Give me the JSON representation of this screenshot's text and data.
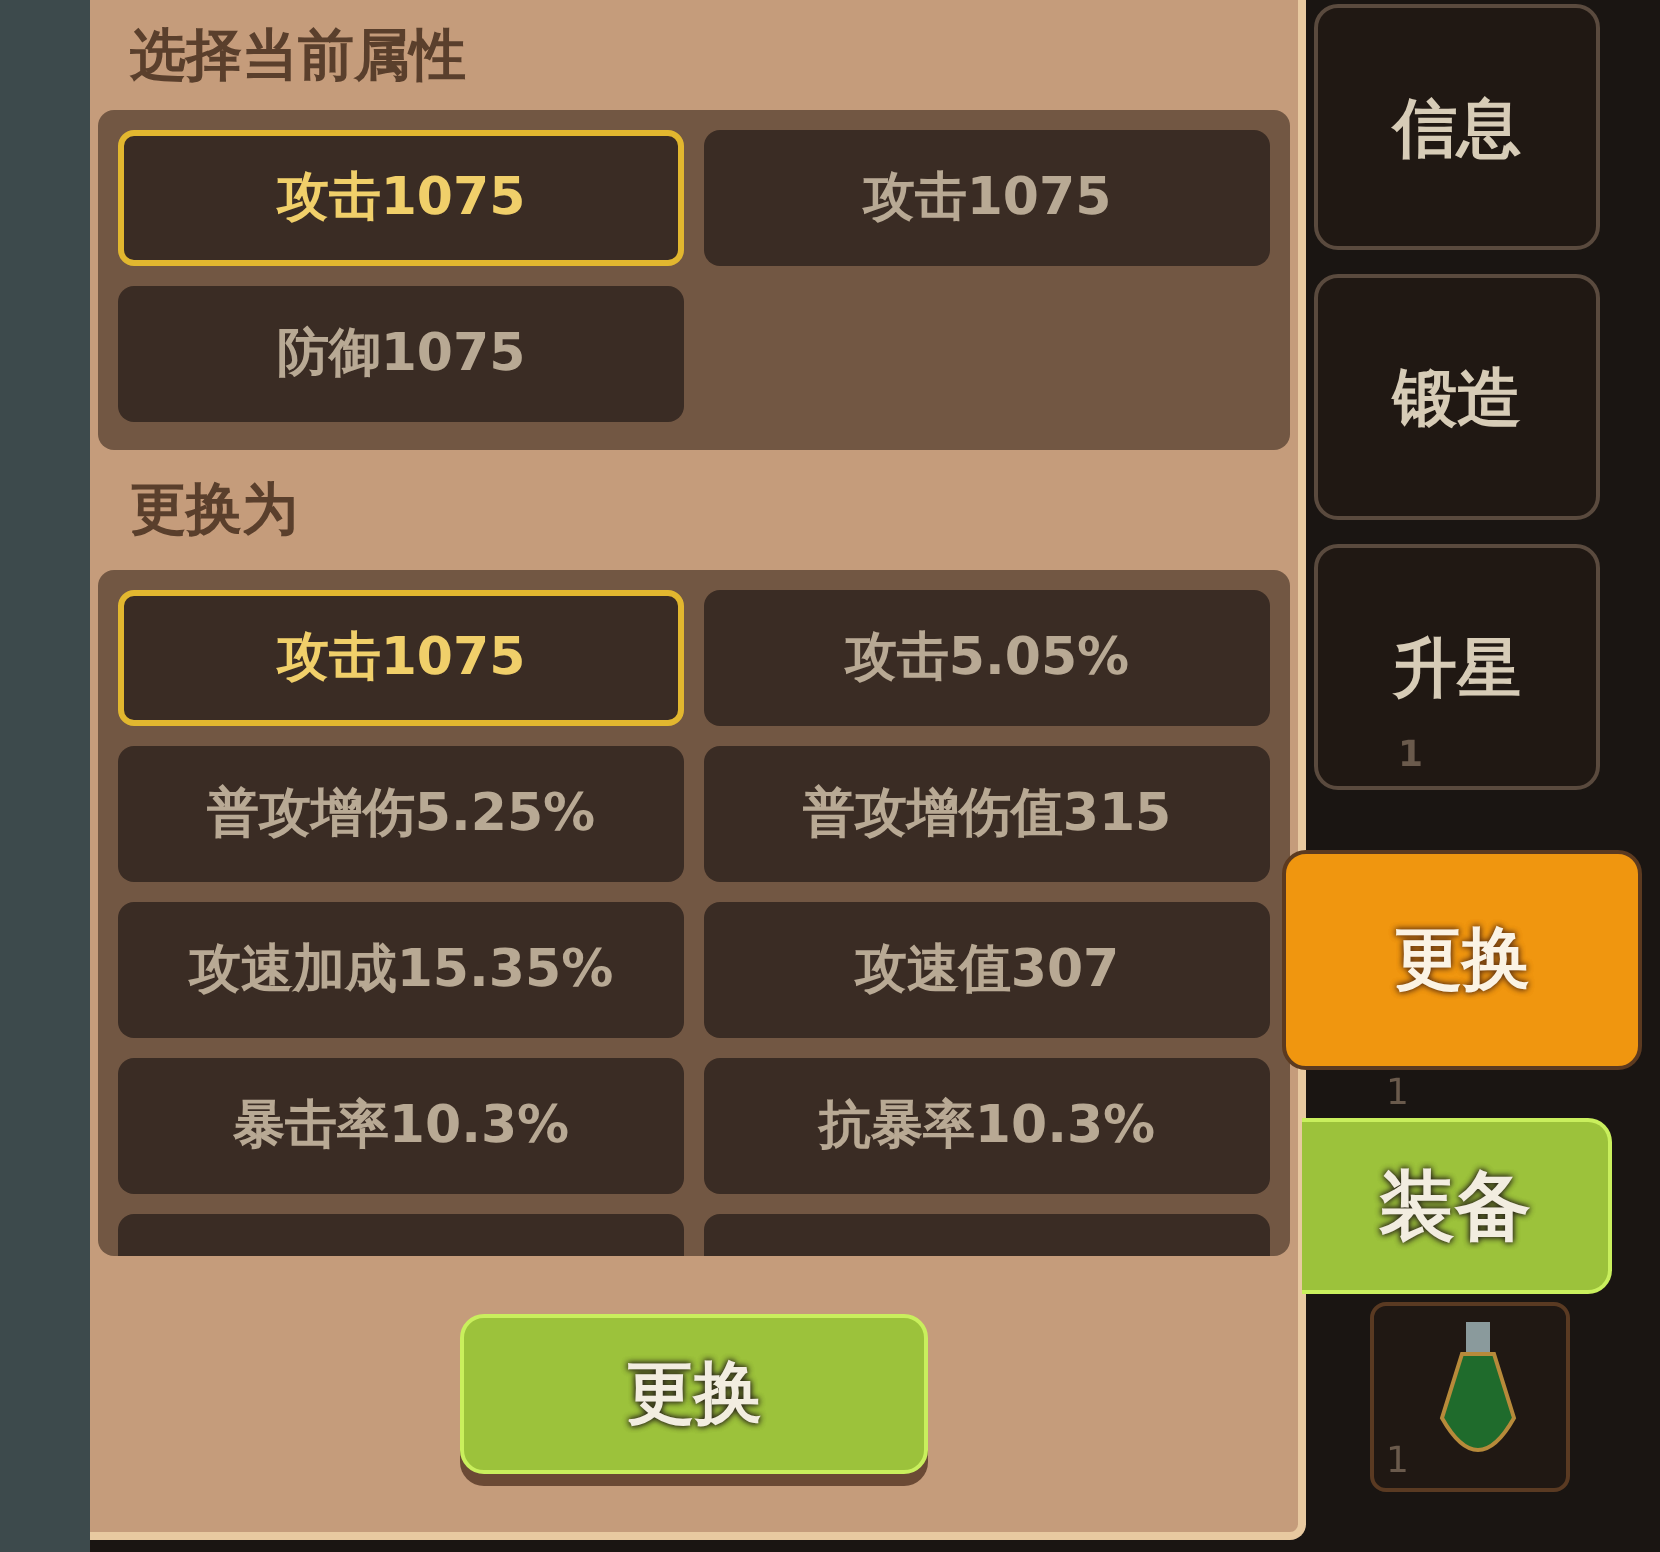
{
  "current_section": {
    "title": "选择当前属性",
    "options": [
      {
        "label": "攻击1075",
        "selected": true
      },
      {
        "label": "攻击1075",
        "selected": false
      },
      {
        "label": "防御1075",
        "selected": false
      }
    ]
  },
  "replace_section": {
    "title": "更换为",
    "options": [
      {
        "label": "攻击1075",
        "selected": true
      },
      {
        "label": "攻击5.05%",
        "selected": false
      },
      {
        "label": "普攻增伤5.25%",
        "selected": false
      },
      {
        "label": "普攻增伤值315",
        "selected": false
      },
      {
        "label": "攻速加成15.35%",
        "selected": false
      },
      {
        "label": "攻速值307",
        "selected": false
      },
      {
        "label": "暴击率10.3%",
        "selected": false
      },
      {
        "label": "抗暴率10.3%",
        "selected": false
      }
    ]
  },
  "confirm_button": "更换",
  "side_tabs": [
    {
      "label": "信息",
      "selected": false
    },
    {
      "label": "锻造",
      "selected": false
    },
    {
      "label": "升星",
      "selected": false,
      "count": "1"
    },
    {
      "label": "更换",
      "selected": true,
      "count": "1"
    }
  ],
  "equip_button": "装备",
  "potion_slot": {
    "count": "1"
  }
}
